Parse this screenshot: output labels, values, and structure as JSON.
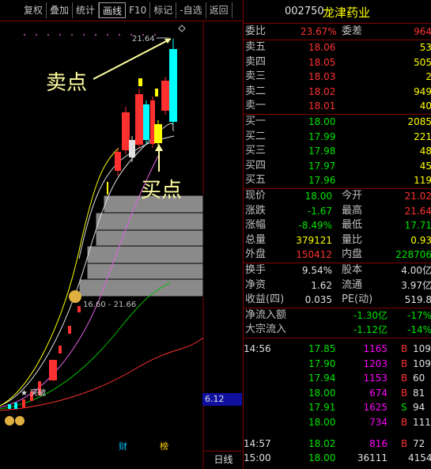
{
  "toolbar": {
    "items": [
      "复权",
      "叠加",
      "统计",
      "画线",
      "F10",
      "标记",
      "-自选",
      "返回"
    ],
    "active": "画线"
  },
  "chart": {
    "high_label": "21.64",
    "range_label": "16.60 - 21.66",
    "star_label": "★ 突破",
    "price_tag": "6.12",
    "sell_annotation": "卖点",
    "buy_annotation": "买点",
    "cai_badge": "财",
    "bang_badge": "榜",
    "bottom_tab": "日线"
  },
  "quote": {
    "code": "002750",
    "name": "龙津药业",
    "weibi_label": "委比",
    "weibi_value": "23.67%",
    "weicha_label": "委差",
    "weicha_value": "964",
    "asks": [
      {
        "label": "卖五",
        "price": "18.06",
        "vol": "53"
      },
      {
        "label": "卖四",
        "price": "18.05",
        "vol": "505"
      },
      {
        "label": "卖三",
        "price": "18.03",
        "vol": "2"
      },
      {
        "label": "卖二",
        "price": "18.02",
        "vol": "949"
      },
      {
        "label": "卖一",
        "price": "18.01",
        "vol": "40"
      }
    ],
    "bids": [
      {
        "label": "买一",
        "price": "18.00",
        "vol": "2085"
      },
      {
        "label": "买二",
        "price": "17.99",
        "vol": "221"
      },
      {
        "label": "买三",
        "price": "17.98",
        "vol": "48"
      },
      {
        "label": "买四",
        "price": "17.97",
        "vol": "45"
      },
      {
        "label": "买五",
        "price": "17.96",
        "vol": "119"
      }
    ],
    "stats": [
      {
        "l1": "现价",
        "v1": "18.00",
        "c1": "grn",
        "l2": "今开",
        "v2": "21.02",
        "c2": "red"
      },
      {
        "l1": "涨跌",
        "v1": "-1.67",
        "c1": "grn",
        "l2": "最高",
        "v2": "21.64",
        "c2": "red"
      },
      {
        "l1": "涨幅",
        "v1": "-8.49%",
        "c1": "grn",
        "l2": "最低",
        "v2": "17.71",
        "c2": "grn"
      },
      {
        "l1": "总量",
        "v1": "379121",
        "c1": "yel",
        "l2": "量比",
        "v2": "0.93",
        "c2": "yel"
      },
      {
        "l1": "外盘",
        "v1": "150412",
        "c1": "red",
        "l2": "内盘",
        "v2": "228706",
        "c2": "grn"
      }
    ],
    "stats2": [
      {
        "l1": "换手",
        "v1": "9.54%",
        "l2": "股本",
        "v2": "4.00亿"
      },
      {
        "l1": "净资",
        "v1": "1.62",
        "l2": "流通",
        "v2": "3.97亿"
      },
      {
        "l1": "收益(四)",
        "v1": "0.035",
        "l2": "PE(动)",
        "v2": "519.8"
      }
    ],
    "flows": [
      {
        "label": "净流入额",
        "value": "-1.30亿",
        "pct": "-17%"
      },
      {
        "label": "大宗流入",
        "value": "-1.12亿",
        "pct": "-14%"
      }
    ],
    "ticks": [
      {
        "time": "14:56",
        "price": "17.85",
        "vol": "1165",
        "side": "B",
        "num": "109"
      },
      {
        "time": "",
        "price": "17.90",
        "vol": "1203",
        "side": "B",
        "num": "109"
      },
      {
        "time": "",
        "price": "17.94",
        "vol": "1153",
        "side": "B",
        "num": "60"
      },
      {
        "time": "",
        "price": "18.00",
        "vol": "674",
        "side": "B",
        "num": "81"
      },
      {
        "time": "",
        "price": "17.91",
        "vol": "1625",
        "side": "S",
        "num": "94"
      },
      {
        "time": "",
        "price": "18.00",
        "vol": "734",
        "side": "B",
        "num": "111"
      },
      {
        "time": "14:57",
        "price": "18.02",
        "vol": "816",
        "side": "B",
        "num": "72"
      },
      {
        "time": "15:00",
        "price": "18.00",
        "vol": "36111",
        "side": "",
        "num": "4154"
      }
    ]
  }
}
